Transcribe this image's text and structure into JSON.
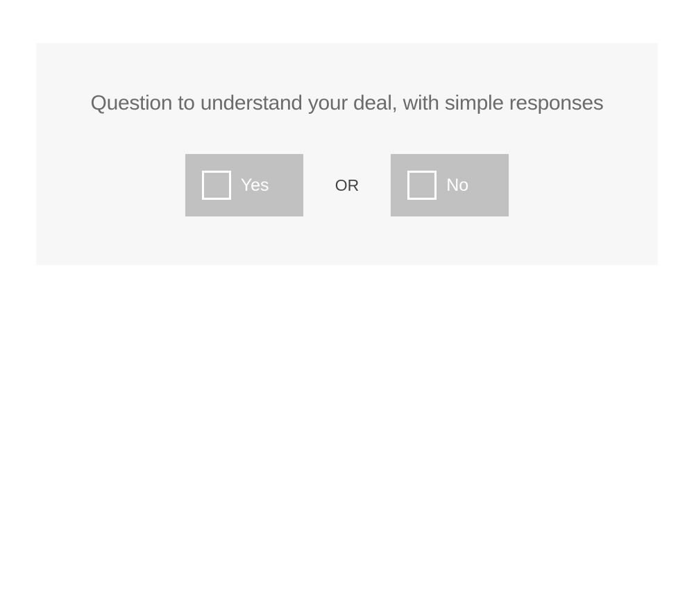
{
  "question": {
    "title": "Question to understand your deal, with simple responses"
  },
  "choices": {
    "yes_label": "Yes",
    "no_label": "No",
    "separator": "OR"
  }
}
